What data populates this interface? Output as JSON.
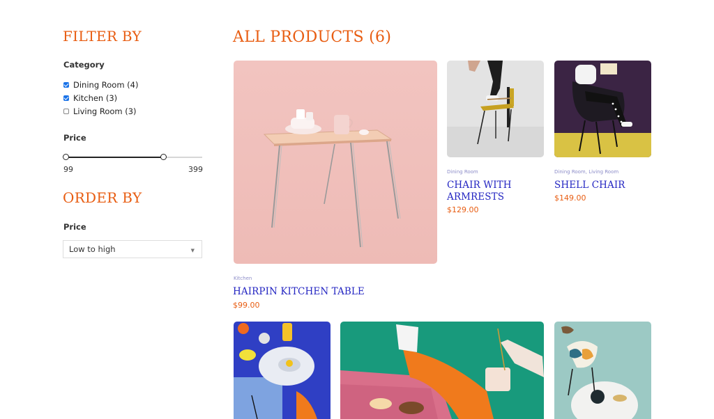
{
  "filters": {
    "heading": "FILTER BY",
    "category": {
      "label": "Category",
      "items": [
        {
          "label": "Dining Room (4)",
          "checked": true
        },
        {
          "label": "Kitchen (3)",
          "checked": true
        },
        {
          "label": "Living Room (3)",
          "checked": false
        }
      ]
    },
    "price": {
      "label": "Price",
      "min_value": "99",
      "max_value": "399",
      "selected_fraction_start": 0.0,
      "selected_fraction_end": 0.72
    }
  },
  "order": {
    "heading": "ORDER BY",
    "label": "Price",
    "selected": "Low to high"
  },
  "main": {
    "heading": "ALL PRODUCTS (6)",
    "products": [
      {
        "category": "Kitchen",
        "title": "HAIRPIN KITCHEN TABLE",
        "price": "$99.00"
      },
      {
        "category": "Dining Room",
        "title": "CHAIR WITH ARMRESTS",
        "price": "$129.00"
      },
      {
        "category": "Dining Room, Living Room",
        "title": "SHELL CHAIR",
        "price": "$149.00"
      }
    ]
  },
  "colors": {
    "accent_orange": "#e85d12",
    "title_blue": "#2426c2",
    "checkbox_blue": "#1a73e8"
  }
}
